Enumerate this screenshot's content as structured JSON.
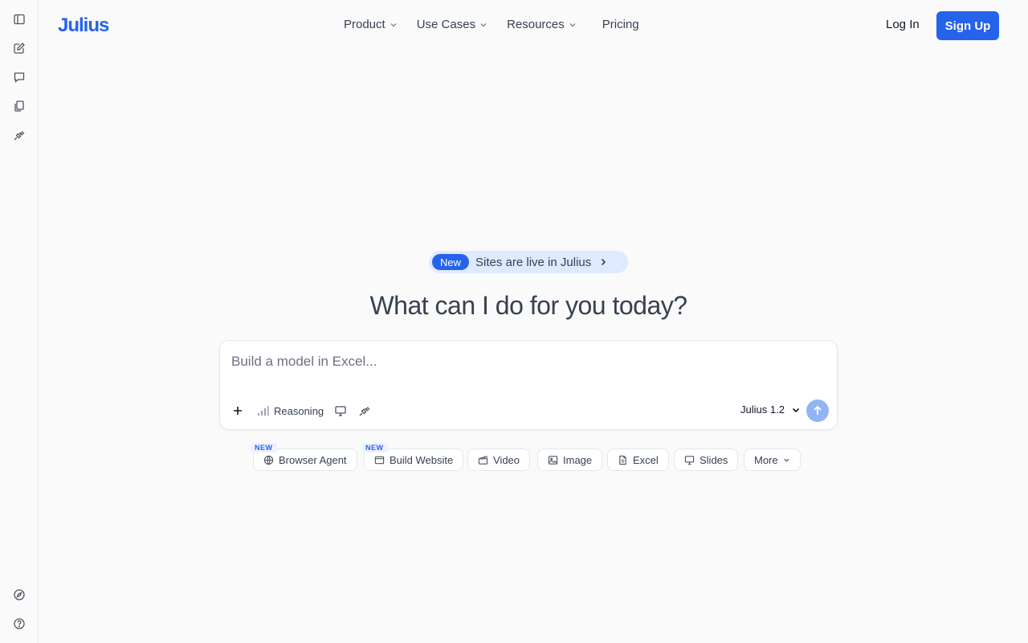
{
  "brand": {
    "name": "Julius",
    "accent": "#2563eb"
  },
  "rail": {
    "top_icons": [
      "sidebar-toggle-icon",
      "new-note-icon",
      "chat-icon",
      "files-icon",
      "plug-icon"
    ],
    "bottom_icons": [
      "compass-icon",
      "help-icon"
    ]
  },
  "nav": {
    "items": [
      {
        "label": "Product",
        "dropdown": true
      },
      {
        "label": "Use Cases",
        "dropdown": true
      },
      {
        "label": "Resources",
        "dropdown": true
      },
      {
        "label": "Pricing",
        "dropdown": false
      }
    ],
    "login_label": "Log In",
    "signup_label": "Sign Up"
  },
  "announcement": {
    "tag": "New",
    "text": "Sites are live in Julius"
  },
  "headline": "What can I do for you today?",
  "composer": {
    "placeholder": "Build a model in Excel...",
    "value": "",
    "reasoning_label": "Reasoning",
    "model_label": "Julius 1.2"
  },
  "chips": [
    {
      "label": "Browser Agent",
      "tag": "NEW",
      "icon": "globe-icon"
    },
    {
      "label": "Build Website",
      "tag": "NEW",
      "icon": "browser-window-icon"
    },
    {
      "label": "Video",
      "tag": "",
      "icon": "clapperboard-icon"
    },
    {
      "label": "Image",
      "tag": "",
      "icon": "image-icon"
    },
    {
      "label": "Excel",
      "tag": "",
      "icon": "document-icon"
    },
    {
      "label": "Slides",
      "tag": "",
      "icon": "presentation-icon"
    },
    {
      "label": "More",
      "tag": "",
      "icon": "chevron-down-icon"
    }
  ]
}
